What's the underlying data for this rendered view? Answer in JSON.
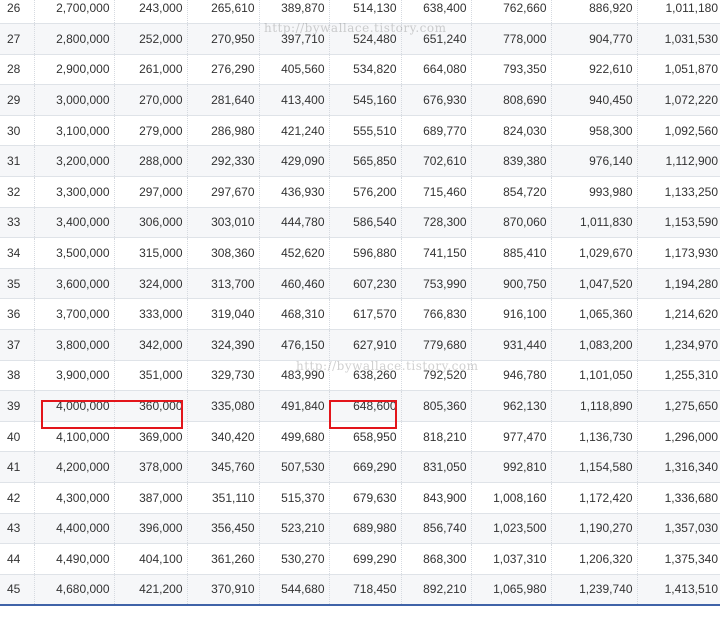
{
  "table": {
    "rows": [
      [
        "26",
        "2,700,000",
        "243,000",
        "265,610",
        "389,870",
        "514,130",
        "638,400",
        "762,660",
        "886,920",
        "1,011,180"
      ],
      [
        "27",
        "2,800,000",
        "252,000",
        "270,950",
        "397,710",
        "524,480",
        "651,240",
        "778,000",
        "904,770",
        "1,031,530"
      ],
      [
        "28",
        "2,900,000",
        "261,000",
        "276,290",
        "405,560",
        "534,820",
        "664,080",
        "793,350",
        "922,610",
        "1,051,870"
      ],
      [
        "29",
        "3,000,000",
        "270,000",
        "281,640",
        "413,400",
        "545,160",
        "676,930",
        "808,690",
        "940,450",
        "1,072,220"
      ],
      [
        "30",
        "3,100,000",
        "279,000",
        "286,980",
        "421,240",
        "555,510",
        "689,770",
        "824,030",
        "958,300",
        "1,092,560"
      ],
      [
        "31",
        "3,200,000",
        "288,000",
        "292,330",
        "429,090",
        "565,850",
        "702,610",
        "839,380",
        "976,140",
        "1,112,900"
      ],
      [
        "32",
        "3,300,000",
        "297,000",
        "297,670",
        "436,930",
        "576,200",
        "715,460",
        "854,720",
        "993,980",
        "1,133,250"
      ],
      [
        "33",
        "3,400,000",
        "306,000",
        "303,010",
        "444,780",
        "586,540",
        "728,300",
        "870,060",
        "1,011,830",
        "1,153,590"
      ],
      [
        "34",
        "3,500,000",
        "315,000",
        "308,360",
        "452,620",
        "596,880",
        "741,150",
        "885,410",
        "1,029,670",
        "1,173,930"
      ],
      [
        "35",
        "3,600,000",
        "324,000",
        "313,700",
        "460,460",
        "607,230",
        "753,990",
        "900,750",
        "1,047,520",
        "1,194,280"
      ],
      [
        "36",
        "3,700,000",
        "333,000",
        "319,040",
        "468,310",
        "617,570",
        "766,830",
        "916,100",
        "1,065,360",
        "1,214,620"
      ],
      [
        "37",
        "3,800,000",
        "342,000",
        "324,390",
        "476,150",
        "627,910",
        "779,680",
        "931,440",
        "1,083,200",
        "1,234,970"
      ],
      [
        "38",
        "3,900,000",
        "351,000",
        "329,730",
        "483,990",
        "638,260",
        "792,520",
        "946,780",
        "1,101,050",
        "1,255,310"
      ],
      [
        "39",
        "4,000,000",
        "360,000",
        "335,080",
        "491,840",
        "648,600",
        "805,360",
        "962,130",
        "1,118,890",
        "1,275,650"
      ],
      [
        "40",
        "4,100,000",
        "369,000",
        "340,420",
        "499,680",
        "658,950",
        "818,210",
        "977,470",
        "1,136,730",
        "1,296,000"
      ],
      [
        "41",
        "4,200,000",
        "378,000",
        "345,760",
        "507,530",
        "669,290",
        "831,050",
        "992,810",
        "1,154,580",
        "1,316,340"
      ],
      [
        "42",
        "4,300,000",
        "387,000",
        "351,110",
        "515,370",
        "679,630",
        "843,900",
        "1,008,160",
        "1,172,420",
        "1,336,680"
      ],
      [
        "43",
        "4,400,000",
        "396,000",
        "356,450",
        "523,210",
        "689,980",
        "856,740",
        "1,023,500",
        "1,190,270",
        "1,357,030"
      ],
      [
        "44",
        "4,490,000",
        "404,100",
        "361,260",
        "530,270",
        "699,290",
        "868,300",
        "1,037,310",
        "1,206,320",
        "1,375,340"
      ],
      [
        "45",
        "4,680,000",
        "421,200",
        "370,910",
        "544,680",
        "718,450",
        "892,210",
        "1,065,980",
        "1,239,740",
        "1,413,510"
      ]
    ]
  },
  "watermarks": [
    "http://bywallace.tistory.com",
    "http://bywallace.tistory.com"
  ],
  "colors": {
    "highlight": "#e3151b",
    "bottom_rule": "#3f63a8",
    "stripe": "#f6f7f9"
  }
}
